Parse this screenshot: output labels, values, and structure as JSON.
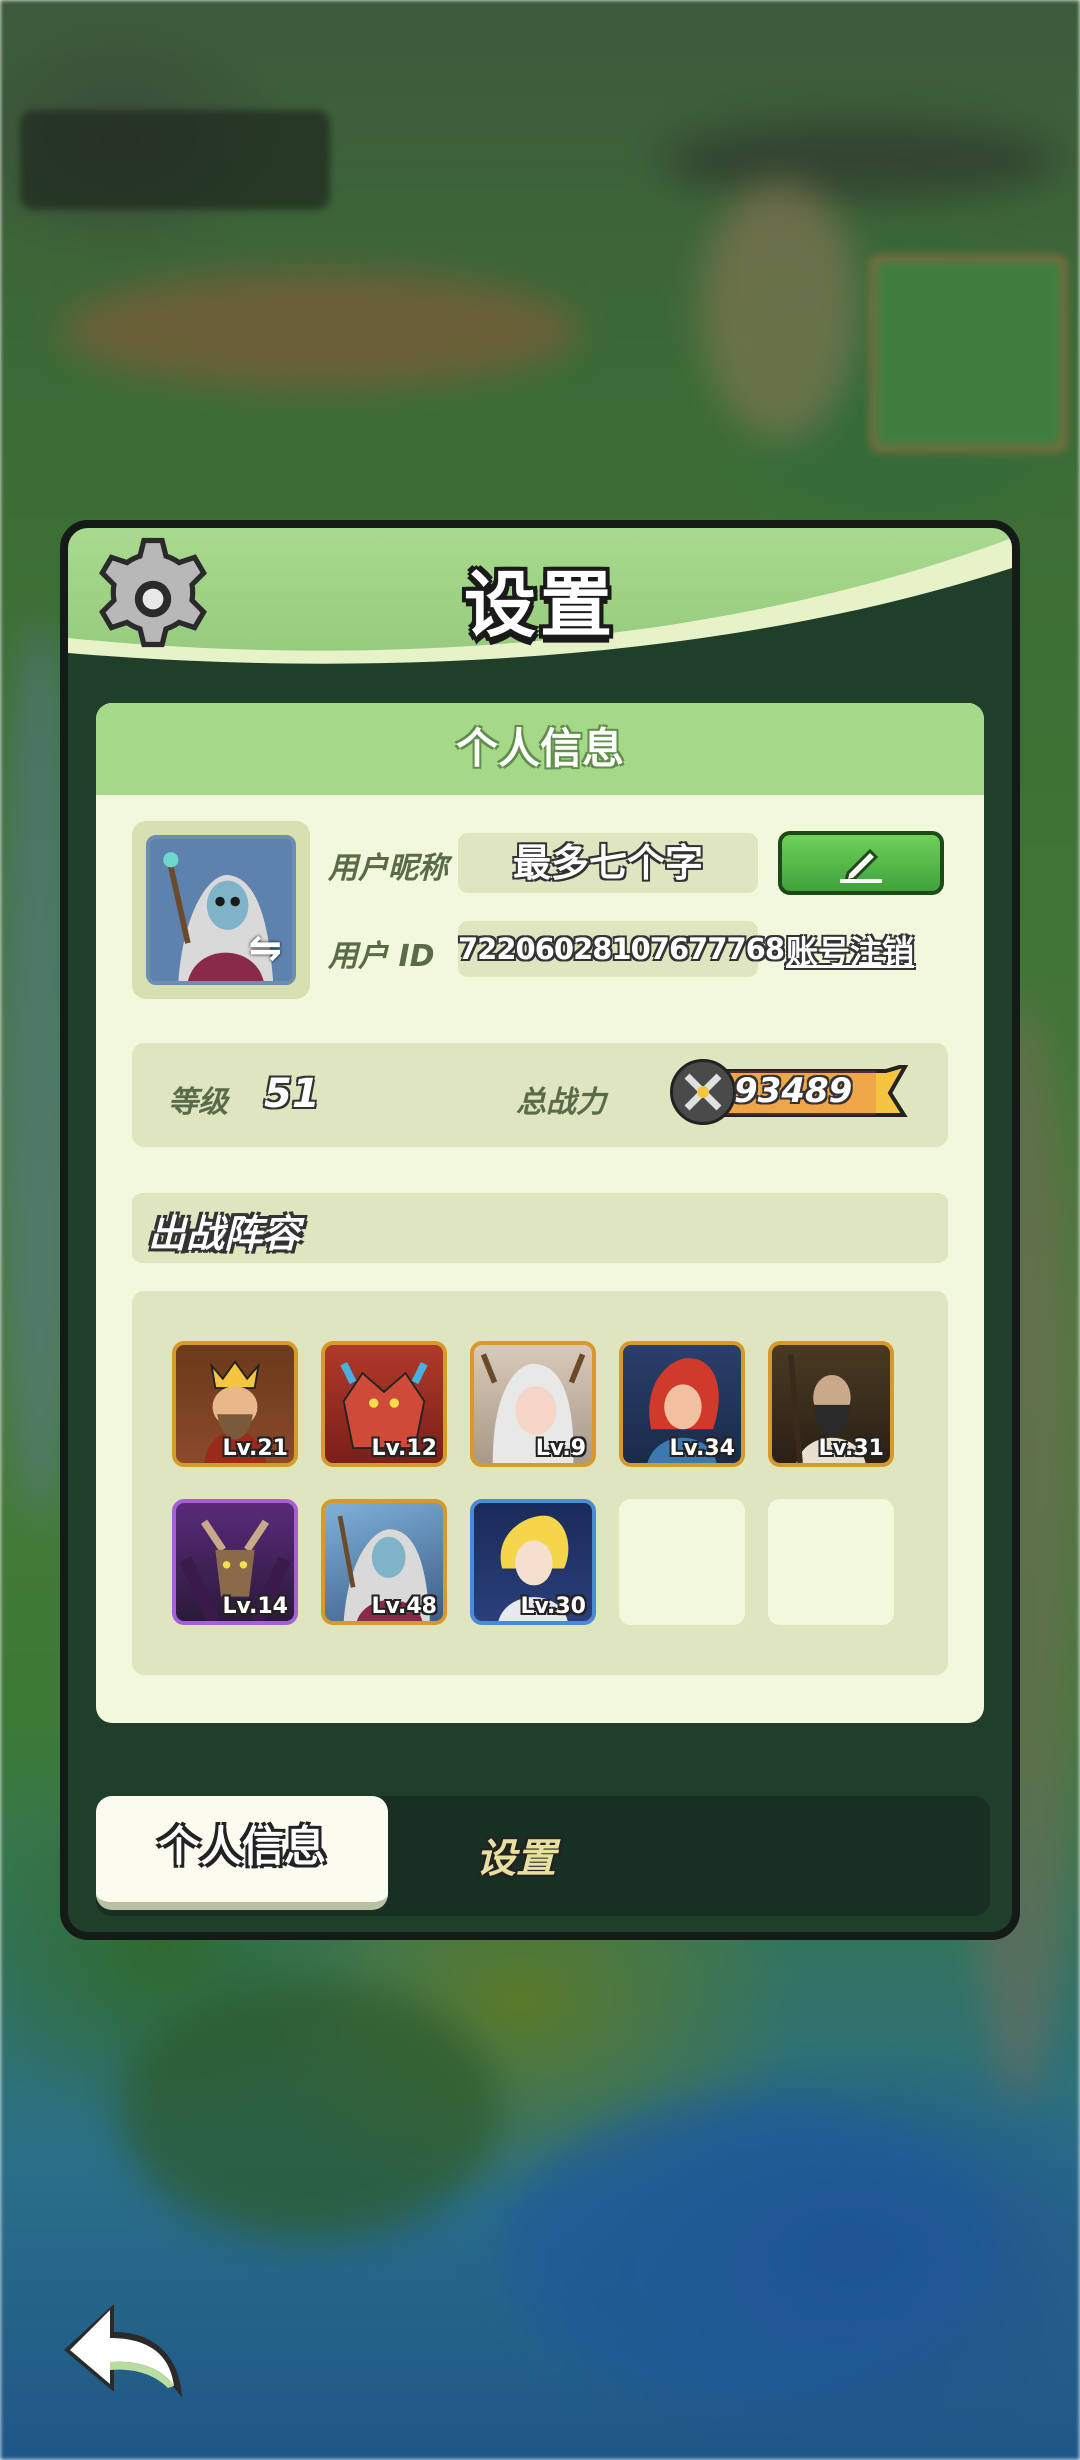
{
  "panel": {
    "title": "设置"
  },
  "profile": {
    "section_title": "个人信息",
    "nickname_label": "用户昵称",
    "nickname_value": "最多七个字",
    "id_label": "用户 ID",
    "id_value": "72206028107677768",
    "cancel_account_label": "账号注销",
    "level_label": "等级",
    "level_value": "51",
    "power_label": "总战力",
    "power_value": "93489"
  },
  "lineup": {
    "title": "出战阵容",
    "heroes": [
      {
        "level": "Lv.21",
        "rarity": "gold",
        "color": "#8a4a2a"
      },
      {
        "level": "Lv.12",
        "rarity": "gold",
        "color": "#b03a2a"
      },
      {
        "level": "Lv.9",
        "rarity": "gold",
        "color": "#c9b9a9"
      },
      {
        "level": "Lv.34",
        "rarity": "gold",
        "color": "#2a3f6a"
      },
      {
        "level": "Lv.31",
        "rarity": "gold",
        "color": "#5a3a22"
      },
      {
        "level": "Lv.14",
        "rarity": "purple",
        "color": "#4a2a6a"
      },
      {
        "level": "Lv.48",
        "rarity": "gold",
        "color": "#3d5d88"
      },
      {
        "level": "Lv.30",
        "rarity": "blue",
        "color": "#2a3f7a"
      },
      {
        "level": "",
        "rarity": "empty"
      },
      {
        "level": "",
        "rarity": "empty"
      }
    ]
  },
  "tabs": {
    "active": "个人信息",
    "inactive": "设置"
  },
  "colors": {
    "accent_green": "#94c97a",
    "panel_dark": "#1f3f2a",
    "card": "#f2f8dc",
    "power_yellow": "#f5c542"
  },
  "icons": [
    "gear-icon",
    "edit-pencil-icon",
    "swap-icon",
    "sword-icon",
    "back-arrow-icon"
  ]
}
